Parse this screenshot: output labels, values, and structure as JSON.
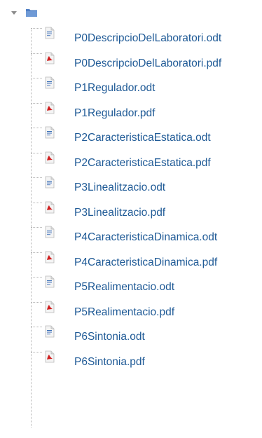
{
  "tree": {
    "root": {
      "toggle_icon": "triangle-down-icon",
      "folder_icon": "folder-icon",
      "folder_color": "#5b86c7"
    },
    "files": [
      {
        "name": "P0DescripcioDelLaboratori.odt",
        "type": "odt"
      },
      {
        "name": "P0DescripcioDelLaboratori.pdf",
        "type": "pdf"
      },
      {
        "name": "P1Regulador.odt",
        "type": "odt"
      },
      {
        "name": "P1Regulador.pdf",
        "type": "pdf"
      },
      {
        "name": "P2CaracteristicaEstatica.odt",
        "type": "odt"
      },
      {
        "name": "P2CaracteristicaEstatica.pdf",
        "type": "pdf"
      },
      {
        "name": "P3Linealitzacio.odt",
        "type": "odt"
      },
      {
        "name": "P3Linealitzacio.pdf",
        "type": "pdf"
      },
      {
        "name": "P4CaracteristicaDinamica.odt",
        "type": "odt"
      },
      {
        "name": "P4CaracteristicaDinamica.pdf",
        "type": "pdf"
      },
      {
        "name": "P5Realimentacio.odt",
        "type": "odt"
      },
      {
        "name": "P5Realimentacio.pdf",
        "type": "pdf"
      },
      {
        "name": "P6Sintonia.odt",
        "type": "odt"
      },
      {
        "name": "P6Sintonia.pdf",
        "type": "pdf"
      }
    ],
    "colors": {
      "link": "#1f5a96",
      "pdf_accent": "#d01f1f",
      "odt_accent": "#3b6fb6"
    }
  }
}
